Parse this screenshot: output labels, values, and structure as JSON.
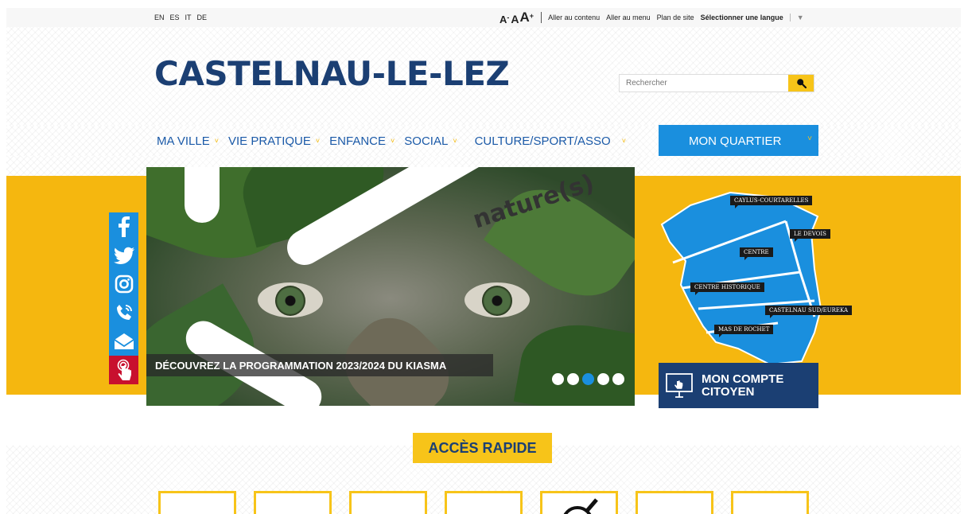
{
  "topbar": {
    "languages": [
      "EN",
      "ES",
      "IT",
      "DE"
    ],
    "font_size": {
      "small": "A",
      "small_sup": "-",
      "medium": "A",
      "large": "A",
      "large_sup": "+"
    },
    "links": {
      "skip_content": "Aller au contenu",
      "skip_menu": "Aller au menu",
      "sitemap": "Plan de site",
      "select_language": "Sélectionner une langue",
      "select_language_caret": "▼"
    }
  },
  "header": {
    "logo": "CASTELNAU-LE-LEZ",
    "search_placeholder": "Rechercher"
  },
  "nav": {
    "items": [
      "MA VILLE",
      "VIE PRATIQUE",
      "ENFANCE",
      "SOCIAL",
      "CULTURE/SPORT/ASSO"
    ],
    "chevron": "˅",
    "highlight": "MON QUARTIER"
  },
  "social": [
    "facebook-icon",
    "twitter-icon",
    "instagram-icon",
    "phone-icon",
    "mail-icon",
    "touch-icon"
  ],
  "slider": {
    "image_text": "nature(s)",
    "caption": "DÉCOUVREZ LA PROGRAMMATION 2023/2024 DU KIASMA",
    "dot_count": 5,
    "active_dot": 2
  },
  "map": {
    "labels": [
      "CAYLUS-COURTARELLES",
      "LE DEVOIS",
      "CENTRE",
      "CENTRE HISTORIQUE",
      "CASTELNAU SUD/EUREKA",
      "MAS DE ROCHET"
    ]
  },
  "compte": {
    "line1": "MON COMPTE",
    "line2": "CITOYEN"
  },
  "acces_rapide": {
    "title": "ACCÈS RAPIDE"
  },
  "colors": {
    "brand_blue": "#1b3f73",
    "accent_blue": "#1a8fde",
    "accent_yellow": "#f7c419",
    "red": "#c8102e"
  }
}
